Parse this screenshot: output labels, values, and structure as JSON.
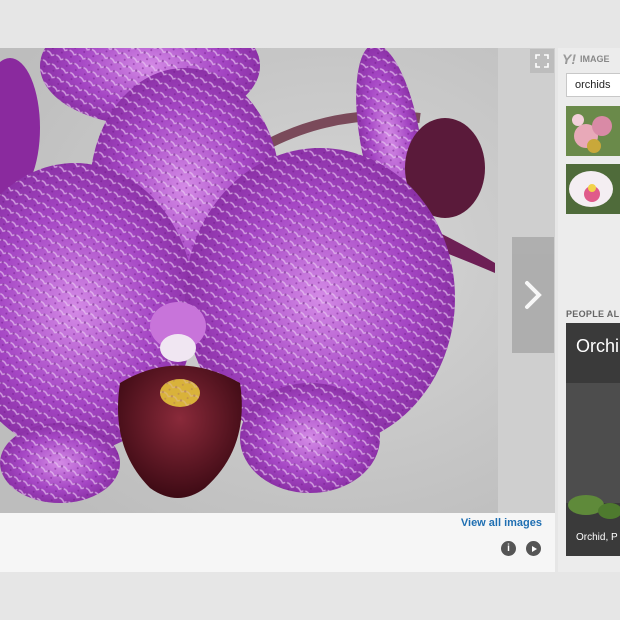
{
  "viewer": {
    "view_all_label": "View all images"
  },
  "sidebar": {
    "brand_text": "IMAGE",
    "search_value": "orchids",
    "related_heading": "PEOPLE AL",
    "card": {
      "title": "Orchi",
      "caption": "Orchid, P"
    }
  },
  "icons": {
    "expand": "expand-icon",
    "next": "chevron-right-icon",
    "info": "info-icon",
    "play": "play-icon"
  },
  "colors": {
    "petal": "#a546c4",
    "link": "#1f6fb2"
  }
}
